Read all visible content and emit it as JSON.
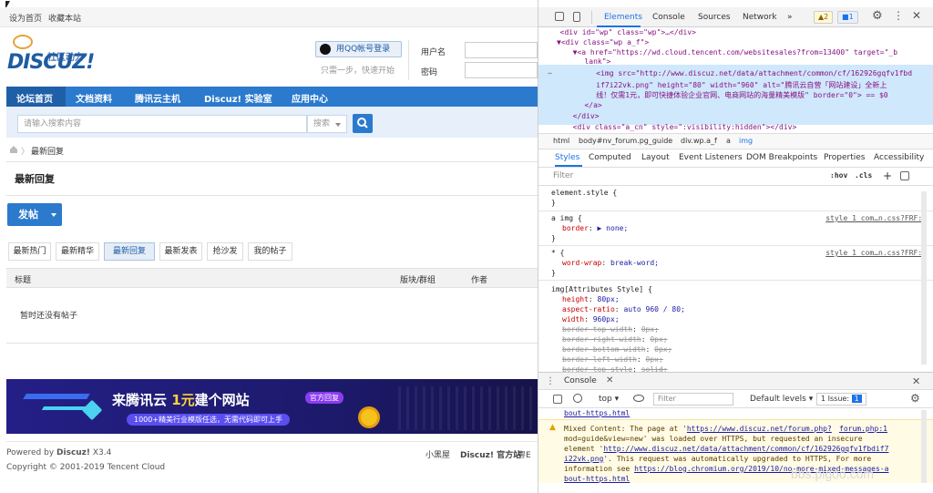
{
  "page": {
    "topbar": {
      "set_home": "设为首页",
      "bookmark": "收藏本站"
    },
    "logo": {
      "brand": "DISCUZ!",
      "tagline": "社区动力"
    },
    "login": {
      "qq_button": "用QQ帐号登录",
      "qq_sub": "只需一步，快速开始",
      "username_label": "用户名",
      "password_label": "密码"
    },
    "nav": {
      "items": [
        "论坛首页",
        "文档资料",
        "腾讯云主机",
        "Discuz! 实验室",
        "应用中心"
      ]
    },
    "search": {
      "placeholder": "请输入搜索内容",
      "scope": "搜索"
    },
    "breadcrumb": {
      "current": "最新回复"
    },
    "section_title": "最新回复",
    "post_button": "发帖",
    "tabs": [
      "最新热门",
      "最新精华",
      "最新回复",
      "最新发表",
      "抢沙发",
      "我的帖子"
    ],
    "active_tab": "最新回复",
    "table_headers": {
      "title": "标题",
      "forum": "版块/群组",
      "author": "作者"
    },
    "empty_text": "暂时还没有帖子",
    "banner": {
      "headline_a": "来腾讯云 ",
      "headline_hl": "1元",
      "headline_b": "建个网站",
      "sub": "1000+精美行业模版任选，无需代码即可上手",
      "tag": "官方回复"
    },
    "footer": {
      "powered": "Powered by ",
      "brand": "Discuz!",
      "version": " X3.4",
      "copyright": "Copyright © 2001-2019 Tencent Cloud",
      "links": [
        "小黑屋",
        "Discuz! 官方站",
        "粤E"
      ]
    }
  },
  "devtools": {
    "tabs": [
      "Elements",
      "Console",
      "Sources",
      "Network"
    ],
    "more": "»",
    "warn_count": "2",
    "msg_count": "1",
    "code": [
      "  <div id=\"wp\" class=\"wp\">…</div>",
      "▼<div class=\"wp a_f\">",
      "  ▼<a href=\"https://wd.cloud.tencent.com/websitesales?from=13400\" target=\"_b",
      "   lank\">",
      "    <img src=\"http://www.discuz.net/data/attachment/common/cf/162926gqfv1fbd",
      "    if7i22vk.png\" height=\"80\" width=\"960\" alt=\"腾讯云自营「网站建设」全新上",
      "    线！仅需1元，即可快捷体验企业官网、电商网站的海量精美模版\" border=\"0\"> == $0",
      "   </a>",
      "  </div>",
      "  <div class=\"a_cn\" style=\":visibility:hidden\"></div>"
    ],
    "crumbs": [
      "html",
      "body#nv_forum.pg_guide",
      "div.wp.a_f",
      "a",
      "img"
    ],
    "subtabs": [
      "Styles",
      "Computed",
      "Layout",
      "Event Listeners",
      "DOM Breakpoints",
      "Properties",
      "Accessibility"
    ],
    "filter_placeholder": "Filter",
    "filter_tools": [
      ":hov",
      ".cls",
      "+"
    ],
    "rules": {
      "element_style": "element.style {",
      "close": "}",
      "a_img_sel": "a img {",
      "a_img_src": "style_1_com…n.css?FRF:1",
      "a_img_prop": "border",
      "a_img_val": "▶ none;",
      "star_sel": "* {",
      "star_src": "style_1_com…n.css?FRF:1",
      "star_prop": "word-wrap",
      "star_val": "break-word;",
      "img_attr_sel": "img[Attributes Style] {",
      "props": [
        {
          "name": "height",
          "value": "80px;",
          "struck": false
        },
        {
          "name": "aspect-ratio",
          "value": "auto 960 / 80;",
          "struck": false
        },
        {
          "name": "width",
          "value": "960px;",
          "struck": false
        },
        {
          "name": "border-top-width",
          "value": "0px;",
          "struck": true
        },
        {
          "name": "border-right-width",
          "value": "0px;",
          "struck": true
        },
        {
          "name": "border-bottom-width",
          "value": "0px;",
          "struck": true
        },
        {
          "name": "border-left-width",
          "value": "0px;",
          "struck": true
        },
        {
          "name": "border-top-style",
          "value": "solid;",
          "struck": true
        }
      ]
    },
    "console": {
      "tab": "Console",
      "context": "top",
      "filter": "Filter",
      "levels": "Default levels",
      "issue": "1 Issue:",
      "issue_count": "1",
      "prev_line": "bout-https.html",
      "warn_lines": [
        {
          "text": "Mixed Content: The page at '",
          "link": "https://www.discuz.net/forum.php?",
          "src": "forum.php:1"
        },
        {
          "text": "mod=guide&view=new' was loaded over HTTPS, but requested an insecure"
        },
        {
          "text": "element '",
          "link": "http://www.discuz.net/data/attachment/common/cf/162926gqfv1fbdif7"
        },
        {
          "link": "i22vk.png",
          "text": "'. This request was automatically upgraded to HTTPS, For more"
        },
        {
          "text": "information see ",
          "link": "https://blog.chromium.org/2019/10/no-more-mixed-messages-a"
        },
        {
          "link": "bout-https.html"
        }
      ]
    }
  },
  "watermark": "bbs.pigoo.com"
}
